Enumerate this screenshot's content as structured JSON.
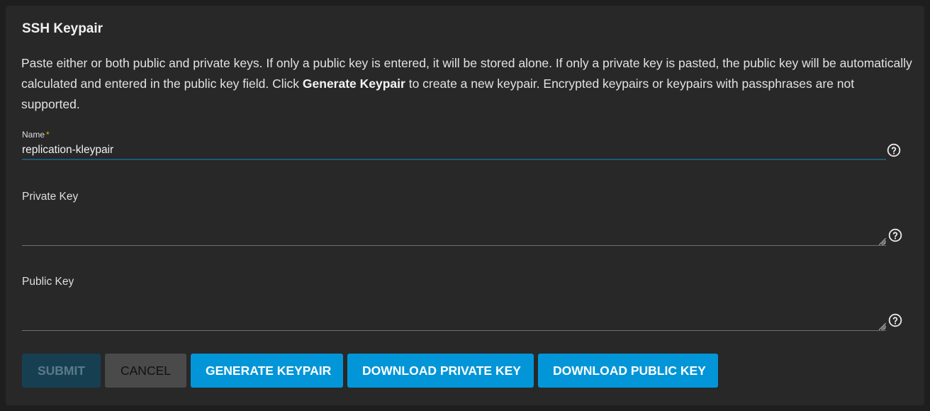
{
  "card": {
    "title": "SSH Keypair",
    "description": {
      "before_bold": "Paste either or both public and private keys. If only a public key is entered, it will be stored alone. If only a private key is pasted, the public key will be automatically calculated and entered in the public key field. Click ",
      "bold": "Generate Keypair",
      "after_bold": " to create a new keypair. Encrypted keypairs or keypairs with passphrases are not supported."
    }
  },
  "fields": {
    "name": {
      "label": "Name",
      "required_marker": "*",
      "value": "replication-kleypair"
    },
    "private_key": {
      "label": "Private Key",
      "value": ""
    },
    "public_key": {
      "label": "Public Key",
      "value": ""
    }
  },
  "actions": {
    "submit_label": "Submit",
    "cancel_label": "Cancel",
    "generate_label": "Generate Keypair",
    "download_private_label": "Download Private Key",
    "download_public_label": "Download Public Key"
  },
  "icons": {
    "help": "help-circle-icon"
  },
  "colors": {
    "background": "#1e1e1e",
    "card": "#282828",
    "primary": "#0296d8",
    "submit_disabled": "#173f52",
    "cancel": "#4a4a4a",
    "required": "#f0b400",
    "focus_underline": "#1d5a77"
  }
}
